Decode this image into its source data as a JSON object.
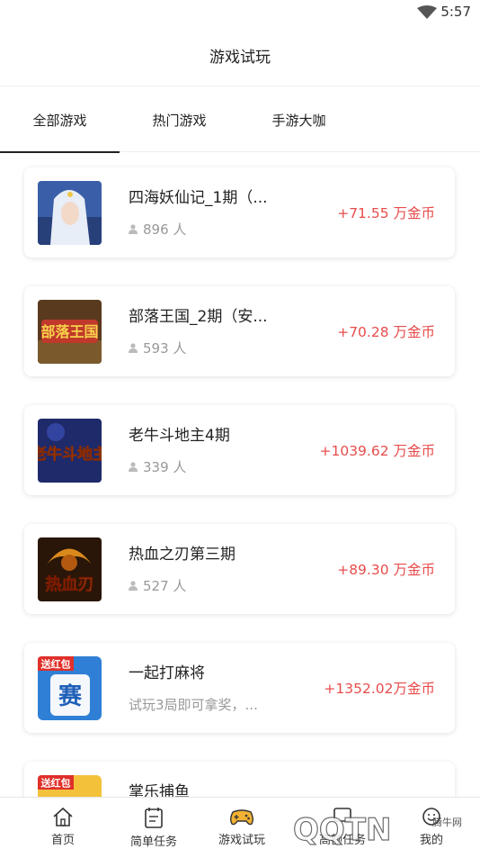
{
  "status": {
    "time": "5:57"
  },
  "header": {
    "title": "游戏试玩"
  },
  "tabs": [
    {
      "label": "全部游戏",
      "active": true
    },
    {
      "label": "热门游戏",
      "active": false
    },
    {
      "label": "手游大咖",
      "active": false
    }
  ],
  "games": [
    {
      "name": "四海妖仙记_1期（...",
      "sub": "896 人",
      "reward": "+71.55 万金币",
      "thumb": "fantasy-heroine"
    },
    {
      "name": "部落王国_2期（安...",
      "sub": "593 人",
      "reward": "+70.28 万金币",
      "thumb": "tribe-kingdom"
    },
    {
      "name": "老牛斗地主4期",
      "sub": "339 人",
      "reward": "+1039.62 万金币",
      "thumb": "doudizhu"
    },
    {
      "name": "热血之刃第三期",
      "sub": "527 人",
      "reward": "+89.30 万金币",
      "thumb": "dragon-blade"
    },
    {
      "name": "一起打麻将",
      "sub": "试玩3局即可拿奖，...",
      "reward": "+1352.02万金币",
      "thumb": "mahjong",
      "badge": "送红包"
    },
    {
      "name": "掌乐捕鱼",
      "sub": "",
      "reward": "",
      "thumb": "fishing",
      "badge": "送红包"
    }
  ],
  "nav": [
    {
      "label": "首页",
      "icon": "home-icon"
    },
    {
      "label": "简单任务",
      "icon": "task-icon"
    },
    {
      "label": "游戏试玩",
      "icon": "gamepad-icon"
    },
    {
      "label": "高额任务",
      "icon": "hand-icon"
    },
    {
      "label": "我的",
      "icon": "profile-icon"
    }
  ],
  "watermark": {
    "brand": "QQTN",
    "site": "腾牛网"
  },
  "colors": {
    "reward": "#e84c4c",
    "tab_indicator": "#222222",
    "gamepad_accent": "#f2b233"
  }
}
